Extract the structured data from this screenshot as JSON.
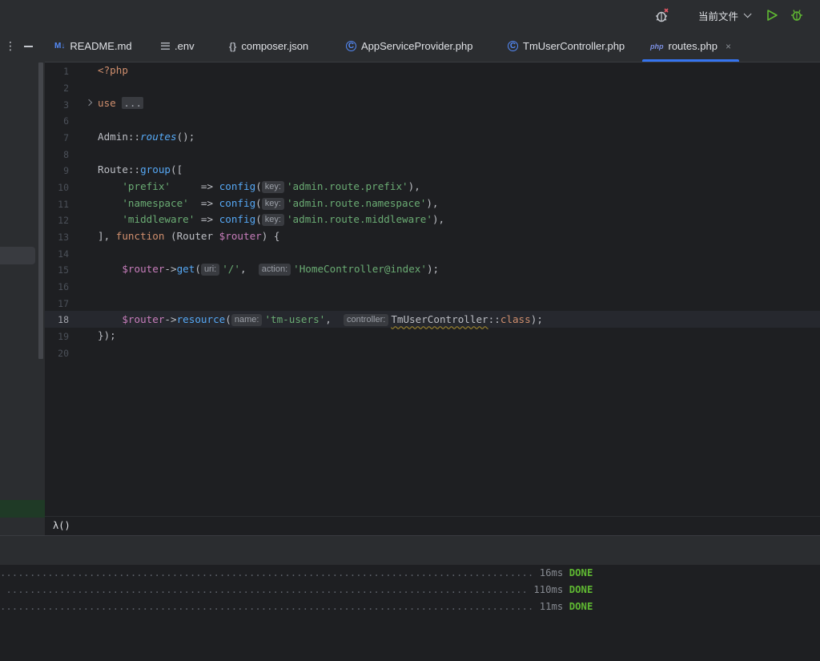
{
  "toolbar": {
    "run_config": "当前文件"
  },
  "tabs": [
    {
      "label": "README.md",
      "icon_text": "M↓"
    },
    {
      "label": ".env"
    },
    {
      "label": "composer.json",
      "icon_text": "{}"
    },
    {
      "label": "AppServiceProvider.php",
      "icon_text": "C"
    },
    {
      "label": "TmUserController.php",
      "icon_text": "C"
    },
    {
      "label": "routes.php",
      "icon_text": "php",
      "close": "×"
    }
  ],
  "line_numbers": [
    "1",
    "2",
    "3",
    "6",
    "7",
    "8",
    "9",
    "10",
    "11",
    "12",
    "13",
    "14",
    "15",
    "16",
    "17",
    "18",
    "19",
    "20"
  ],
  "code": {
    "l1": "<?php",
    "l3_use": "use",
    "l3_fold": "...",
    "l7_cls": "Admin::",
    "l7_fn": "routes",
    "l7_end": "();",
    "l9_cls": "Route::",
    "l9_fn": "group",
    "l9_end": "([",
    "l10_key": "'prefix'",
    "l10_arrow": "     => ",
    "l10_hint": "key:",
    "l10_val": "'admin.route.prefix'",
    "l11_key": "'namespace'",
    "l11_arrow": "  => ",
    "l11_val": "'admin.route.namespace'",
    "l12_key": "'middleware'",
    "l12_arrow": " => ",
    "l12_val": "'middleware'",
    "l12_valfull": "'admin.route.middleware'",
    "config_fn": "config",
    "l13_a": "], ",
    "l13_fn": "function",
    "l13_b": " (Router ",
    "l13_var": "$router",
    "l13_c": ") {",
    "router_var": "$router",
    "l15_arrow": "->",
    "l15_fn": "get",
    "l15_hint1": "uri:",
    "l15_val1": "'/'",
    "l15_hint2": "action:",
    "l15_val2": "'HomeController@index'",
    "l18_fn": "resource",
    "l18_hint1": "name:",
    "l18_val1": "'tm-users'",
    "l18_hint2": "controller:",
    "l18_cls": "TmUserController",
    "l18_sep": "::",
    "l18_kw": "class",
    "l19": "});"
  },
  "breadcrumb": "λ()",
  "console": [
    {
      "time": "16ms",
      "status": "DONE"
    },
    {
      "time": "110ms",
      "status": "DONE"
    },
    {
      "time": "11ms",
      "status": "DONE"
    }
  ]
}
